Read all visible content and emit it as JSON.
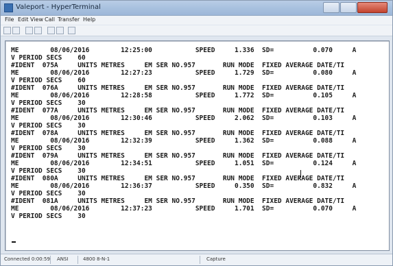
{
  "window": {
    "title": "Valeport - HyperTerminal"
  },
  "menu": [
    "File",
    "Edit",
    "View",
    "Call",
    "Transfer",
    "Help"
  ],
  "toolbar": {
    "icons": [
      "new-icon",
      "open-icon",
      "disconnect-icon",
      "call-icon",
      "send-icon",
      "receive-icon",
      "properties-icon"
    ]
  },
  "terminal": {
    "lines": [
      "ME        08/06/2016        12:25:00           SPEED     1.336  SD=          0.070     A",
      "V PERIOD SECS    60",
      "#IDENT  075A     UNITS METRES     EM SER NO.957       RUN MODE  FIXED AVERAGE DATE/TI",
      "ME        08/06/2016        12:27:23           SPEED     1.729  SD=          0.080     A",
      "V PERIOD SECS    60",
      "#IDENT  076A     UNITS METRES     EM SER NO.957       RUN MODE  FIXED AVERAGE DATE/TI",
      "ME        08/06/2016        12:28:58           SPEED     1.772  SD=          0.105     A",
      "V PERIOD SECS    30",
      "#IDENT  077A     UNITS METRES     EM SER NO.957       RUN MODE  FIXED AVERAGE DATE/TI",
      "ME        08/06/2016        12:30:46           SPEED     2.062  SD=          0.103     A",
      "V PERIOD SECS    30",
      "#IDENT  078A     UNITS METRES     EM SER NO.957       RUN MODE  FIXED AVERAGE DATE/TI",
      "ME        08/06/2016        12:32:39           SPEED     1.362  SD=          0.088     A",
      "V PERIOD SECS    30",
      "#IDENT  079A     UNITS METRES     EM SER NO.957       RUN MODE  FIXED AVERAGE DATE/TI",
      "ME        08/06/2016        12:34:51           SPEED     1.051  SD=          0.124     A",
      "V PERIOD SECS    30",
      "#IDENT  080A     UNITS METRES     EM SER NO.957       RUN MODE  FIXED AVERAGE DATE/TI",
      "ME        08/06/2016        12:36:37           SPEED     0.350  SD=          0.832     A",
      "V PERIOD SECS    30",
      "#IDENT  081A     UNITS METRES     EM SER NO.957       RUN MODE  FIXED AVERAGE DATE/TI",
      "ME        08/06/2016        12:37:23           SPEED     1.701  SD=          0.070     A",
      "V PERIOD SECS    30"
    ]
  },
  "status": {
    "connected": "Connected 0:00:59",
    "emulation": "ANSI",
    "settings": "4800 8-N-1",
    "capture": "Capture"
  },
  "colors": {
    "titlebar": "#a7c0de",
    "terminal_bg": "#ffffff",
    "terminal_text": "#1a1a1a"
  }
}
